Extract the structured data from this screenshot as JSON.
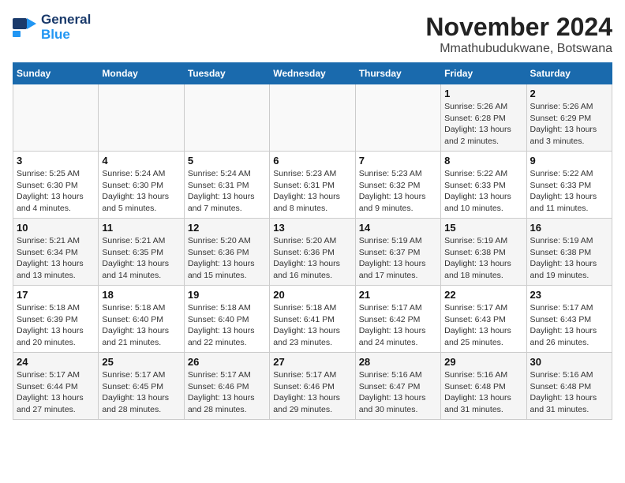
{
  "header": {
    "logo_line1": "General",
    "logo_line2": "Blue",
    "month": "November 2024",
    "location": "Mmathubudukwane, Botswana"
  },
  "weekdays": [
    "Sunday",
    "Monday",
    "Tuesday",
    "Wednesday",
    "Thursday",
    "Friday",
    "Saturday"
  ],
  "weeks": [
    [
      {
        "day": "",
        "info": ""
      },
      {
        "day": "",
        "info": ""
      },
      {
        "day": "",
        "info": ""
      },
      {
        "day": "",
        "info": ""
      },
      {
        "day": "",
        "info": ""
      },
      {
        "day": "1",
        "info": "Sunrise: 5:26 AM\nSunset: 6:28 PM\nDaylight: 13 hours and 2 minutes."
      },
      {
        "day": "2",
        "info": "Sunrise: 5:26 AM\nSunset: 6:29 PM\nDaylight: 13 hours and 3 minutes."
      }
    ],
    [
      {
        "day": "3",
        "info": "Sunrise: 5:25 AM\nSunset: 6:30 PM\nDaylight: 13 hours and 4 minutes."
      },
      {
        "day": "4",
        "info": "Sunrise: 5:24 AM\nSunset: 6:30 PM\nDaylight: 13 hours and 5 minutes."
      },
      {
        "day": "5",
        "info": "Sunrise: 5:24 AM\nSunset: 6:31 PM\nDaylight: 13 hours and 7 minutes."
      },
      {
        "day": "6",
        "info": "Sunrise: 5:23 AM\nSunset: 6:31 PM\nDaylight: 13 hours and 8 minutes."
      },
      {
        "day": "7",
        "info": "Sunrise: 5:23 AM\nSunset: 6:32 PM\nDaylight: 13 hours and 9 minutes."
      },
      {
        "day": "8",
        "info": "Sunrise: 5:22 AM\nSunset: 6:33 PM\nDaylight: 13 hours and 10 minutes."
      },
      {
        "day": "9",
        "info": "Sunrise: 5:22 AM\nSunset: 6:33 PM\nDaylight: 13 hours and 11 minutes."
      }
    ],
    [
      {
        "day": "10",
        "info": "Sunrise: 5:21 AM\nSunset: 6:34 PM\nDaylight: 13 hours and 13 minutes."
      },
      {
        "day": "11",
        "info": "Sunrise: 5:21 AM\nSunset: 6:35 PM\nDaylight: 13 hours and 14 minutes."
      },
      {
        "day": "12",
        "info": "Sunrise: 5:20 AM\nSunset: 6:36 PM\nDaylight: 13 hours and 15 minutes."
      },
      {
        "day": "13",
        "info": "Sunrise: 5:20 AM\nSunset: 6:36 PM\nDaylight: 13 hours and 16 minutes."
      },
      {
        "day": "14",
        "info": "Sunrise: 5:19 AM\nSunset: 6:37 PM\nDaylight: 13 hours and 17 minutes."
      },
      {
        "day": "15",
        "info": "Sunrise: 5:19 AM\nSunset: 6:38 PM\nDaylight: 13 hours and 18 minutes."
      },
      {
        "day": "16",
        "info": "Sunrise: 5:19 AM\nSunset: 6:38 PM\nDaylight: 13 hours and 19 minutes."
      }
    ],
    [
      {
        "day": "17",
        "info": "Sunrise: 5:18 AM\nSunset: 6:39 PM\nDaylight: 13 hours and 20 minutes."
      },
      {
        "day": "18",
        "info": "Sunrise: 5:18 AM\nSunset: 6:40 PM\nDaylight: 13 hours and 21 minutes."
      },
      {
        "day": "19",
        "info": "Sunrise: 5:18 AM\nSunset: 6:40 PM\nDaylight: 13 hours and 22 minutes."
      },
      {
        "day": "20",
        "info": "Sunrise: 5:18 AM\nSunset: 6:41 PM\nDaylight: 13 hours and 23 minutes."
      },
      {
        "day": "21",
        "info": "Sunrise: 5:17 AM\nSunset: 6:42 PM\nDaylight: 13 hours and 24 minutes."
      },
      {
        "day": "22",
        "info": "Sunrise: 5:17 AM\nSunset: 6:43 PM\nDaylight: 13 hours and 25 minutes."
      },
      {
        "day": "23",
        "info": "Sunrise: 5:17 AM\nSunset: 6:43 PM\nDaylight: 13 hours and 26 minutes."
      }
    ],
    [
      {
        "day": "24",
        "info": "Sunrise: 5:17 AM\nSunset: 6:44 PM\nDaylight: 13 hours and 27 minutes."
      },
      {
        "day": "25",
        "info": "Sunrise: 5:17 AM\nSunset: 6:45 PM\nDaylight: 13 hours and 28 minutes."
      },
      {
        "day": "26",
        "info": "Sunrise: 5:17 AM\nSunset: 6:46 PM\nDaylight: 13 hours and 28 minutes."
      },
      {
        "day": "27",
        "info": "Sunrise: 5:17 AM\nSunset: 6:46 PM\nDaylight: 13 hours and 29 minutes."
      },
      {
        "day": "28",
        "info": "Sunrise: 5:16 AM\nSunset: 6:47 PM\nDaylight: 13 hours and 30 minutes."
      },
      {
        "day": "29",
        "info": "Sunrise: 5:16 AM\nSunset: 6:48 PM\nDaylight: 13 hours and 31 minutes."
      },
      {
        "day": "30",
        "info": "Sunrise: 5:16 AM\nSunset: 6:48 PM\nDaylight: 13 hours and 31 minutes."
      }
    ]
  ]
}
